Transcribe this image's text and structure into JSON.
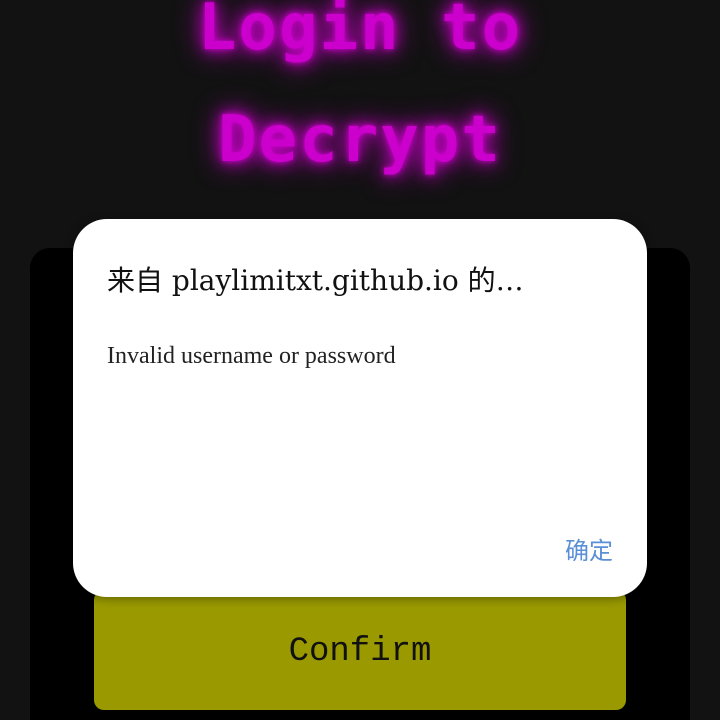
{
  "colors": {
    "background": "#121212",
    "neon_title": "#cc00cc",
    "panel": "#000000",
    "confirm_button": "#9a9a00",
    "dialog_ok": "#5b8fd6"
  },
  "page": {
    "title_line1": "Login to",
    "title_line2": "Decrypt",
    "confirm_label": "Confirm"
  },
  "dialog": {
    "title": "来自 playlimitxt.github.io 的…",
    "message": "Invalid username or password",
    "ok_label": "确定"
  }
}
